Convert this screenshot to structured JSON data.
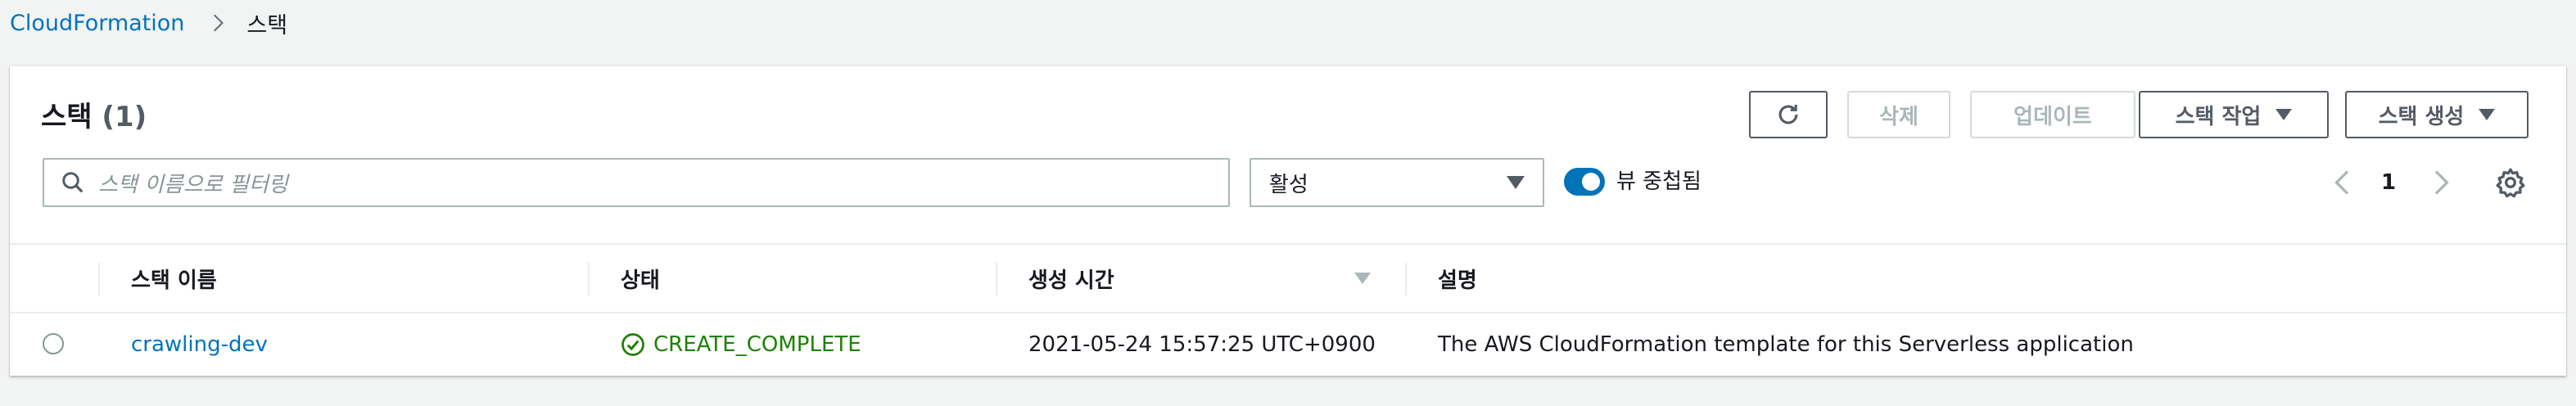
{
  "breadcrumb": {
    "root": "CloudFormation",
    "current": "스택"
  },
  "panel": {
    "title": "스택",
    "count": "(1)",
    "refresh_icon": "refresh-icon",
    "delete_label": "삭제",
    "update_label": "업데이트",
    "stack_actions_label": "스택 작업",
    "create_stack_label": "스택 생성"
  },
  "filter": {
    "search_placeholder": "스택 이름으로 필터링",
    "status_selected": "활성",
    "nested_label": "뷰 중첩됨",
    "nested_on": true
  },
  "pagination": {
    "current_page": "1"
  },
  "table": {
    "headers": {
      "name": "스택 이름",
      "status": "상태",
      "created": "생성 시간",
      "description": "설명"
    },
    "rows": [
      {
        "name": "crawling-dev",
        "status": "CREATE_COMPLETE",
        "created": "2021-05-24 15:57:25 UTC+0900",
        "description": "The AWS CloudFormation template for this Serverless application"
      }
    ]
  },
  "colors": {
    "link": "#0073bb",
    "success": "#1d8102",
    "accent": "#0073bb"
  }
}
